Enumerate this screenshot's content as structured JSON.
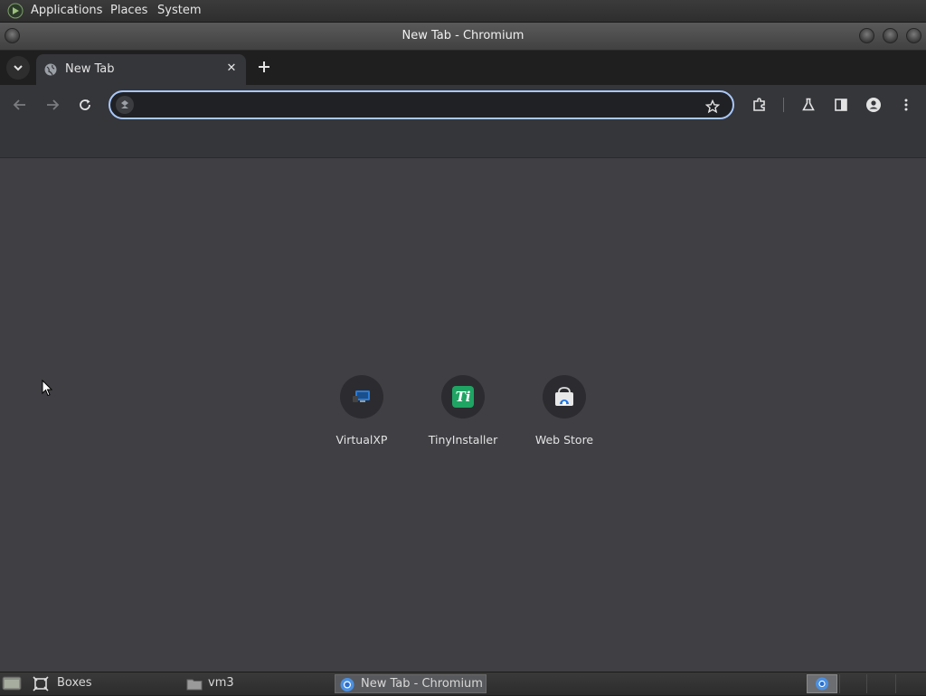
{
  "top_panel": {
    "menus": [
      "Applications",
      "Places",
      "System"
    ]
  },
  "window": {
    "title": "New Tab - Chromium"
  },
  "tabs": [
    {
      "label": "New Tab",
      "icon": "globe-icon",
      "active": true
    }
  ],
  "toolbar": {
    "omnibox_value": "",
    "omnibox_placeholder": ""
  },
  "shortcuts": [
    {
      "label": "VirtualXP",
      "icon": "virtualxp-icon"
    },
    {
      "label": "TinyInstaller",
      "icon": "tinyinstaller-icon",
      "glyph": "Ti"
    },
    {
      "label": "Web Store",
      "icon": "web-store-icon"
    }
  ],
  "taskbar": {
    "items": [
      {
        "label": "Boxes",
        "icon": "boxes-icon"
      },
      {
        "label": "vm3",
        "icon": "folder-icon"
      },
      {
        "label": "New Tab - Chromium",
        "icon": "chromium-icon",
        "active": true
      }
    ]
  },
  "colors": {
    "content_bg": "#3f3f44",
    "omnibox_focus": "#a8c7fa",
    "toolbar_bg": "#35363a",
    "tinyinstaller_green": "#1fa463"
  }
}
